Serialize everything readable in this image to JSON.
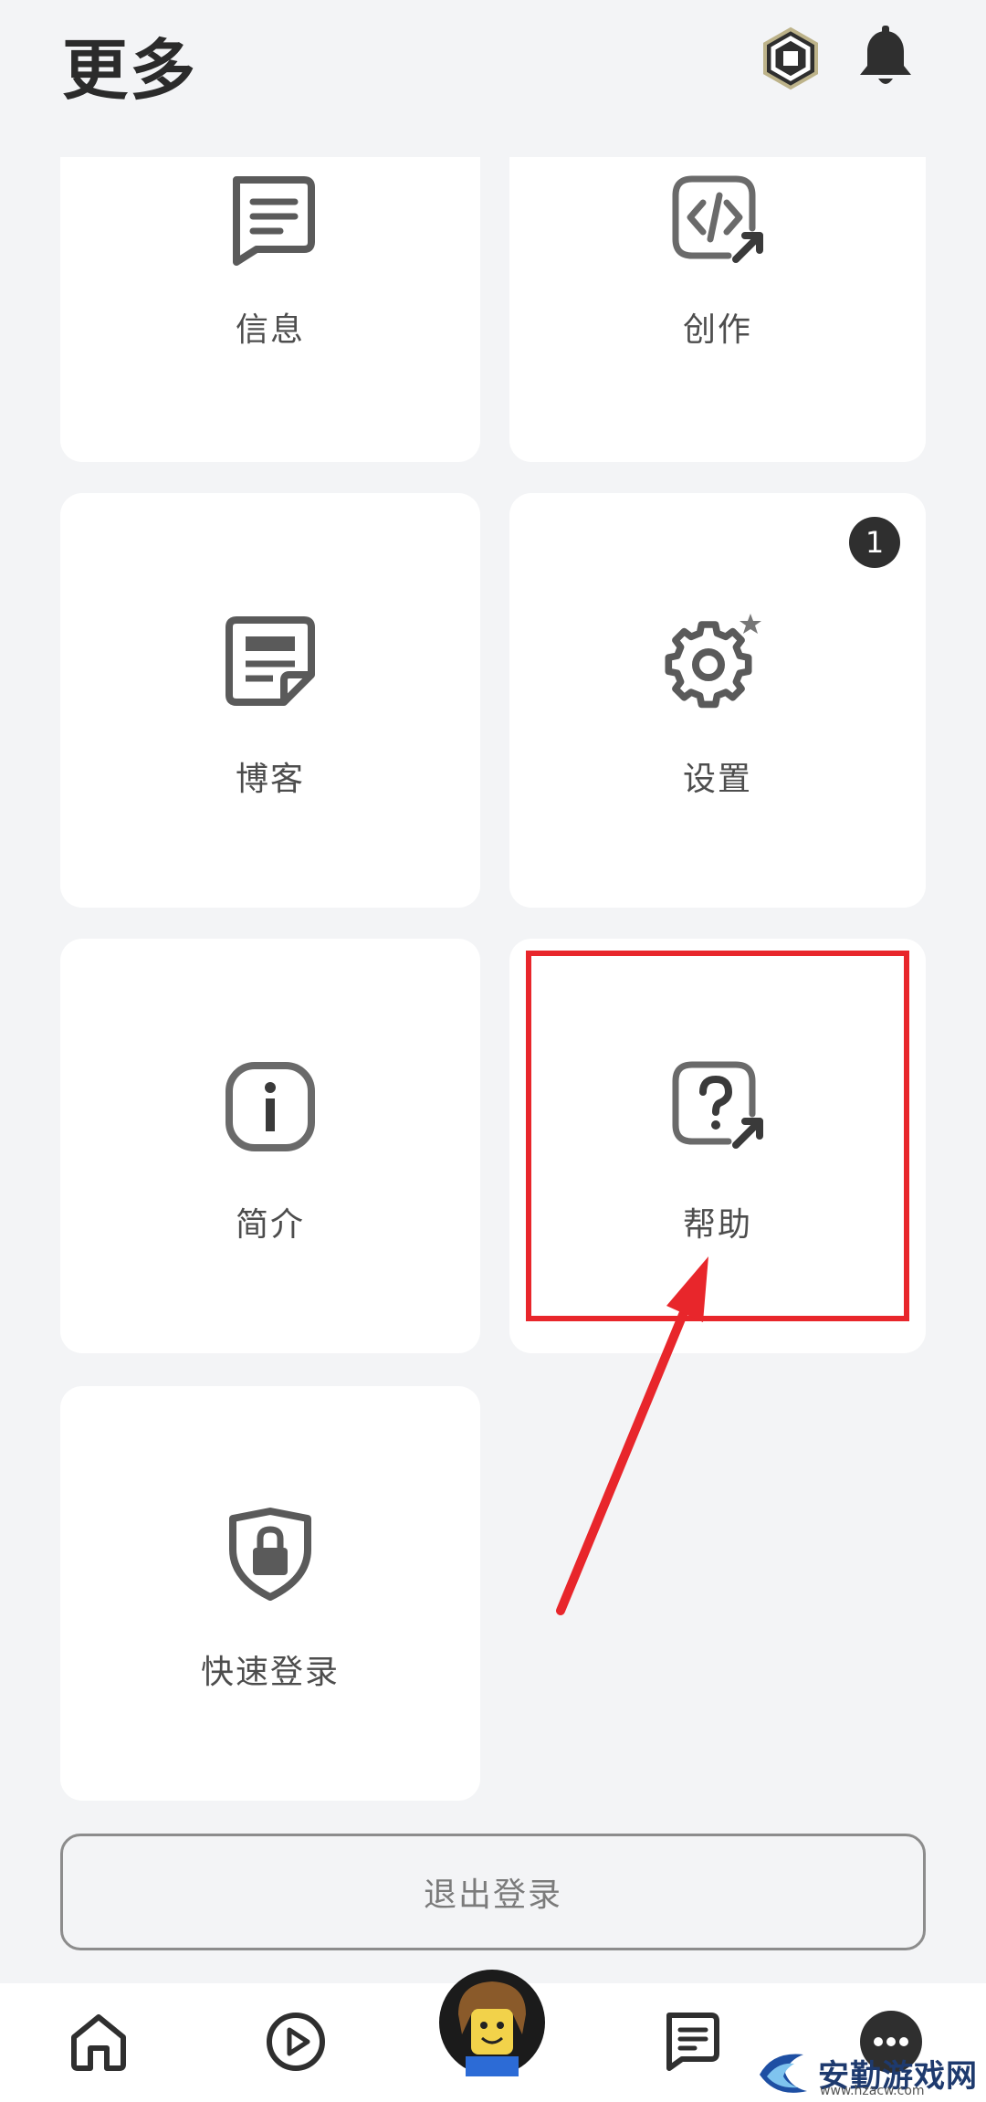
{
  "header": {
    "title": "更多",
    "robux_icon": "robux-icon",
    "notification_icon": "bell-icon"
  },
  "tiles": [
    {
      "label": "信息",
      "icon": "message-icon"
    },
    {
      "label": "创作",
      "icon": "code-external-icon"
    },
    {
      "label": "博客",
      "icon": "blog-icon"
    },
    {
      "label": "设置",
      "icon": "settings-gear-icon",
      "badge": "1"
    },
    {
      "label": "简介",
      "icon": "info-icon"
    },
    {
      "label": "帮助",
      "icon": "help-external-icon"
    },
    {
      "label": "快速登录",
      "icon": "shield-lock-icon"
    }
  ],
  "logout_label": "退出登录",
  "bottom_nav": [
    {
      "name": "home",
      "icon": "home-icon"
    },
    {
      "name": "discover",
      "icon": "play-icon"
    },
    {
      "name": "avatar",
      "icon": "avatar-icon"
    },
    {
      "name": "chat",
      "icon": "chat-icon"
    },
    {
      "name": "more",
      "icon": "more-icon"
    }
  ],
  "watermark": {
    "text": "安勤游戏网",
    "sub": "www.hzacw.com"
  },
  "colors": {
    "background": "#f3f4f6",
    "tile": "#ffffff",
    "icon": "#5a5a5a",
    "highlight": "#e8262b"
  }
}
